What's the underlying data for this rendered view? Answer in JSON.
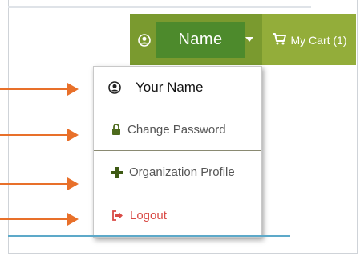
{
  "header": {
    "user_name": "Name",
    "cart_label": "My Cart (1)"
  },
  "menu": {
    "items": [
      {
        "label": "Your Name",
        "icon": "user-circle-icon"
      },
      {
        "label": "Change Password",
        "icon": "lock-icon"
      },
      {
        "label": "Organization Profile",
        "icon": "plus-icon"
      },
      {
        "label": "Logout",
        "icon": "logout-icon"
      }
    ]
  },
  "colors": {
    "user_button": "#7a9a2f",
    "name_box": "#4d8a2c",
    "cart_button": "#93ad3a",
    "logout_text": "#d94a45",
    "annotation_arrows": "#e8702a"
  }
}
